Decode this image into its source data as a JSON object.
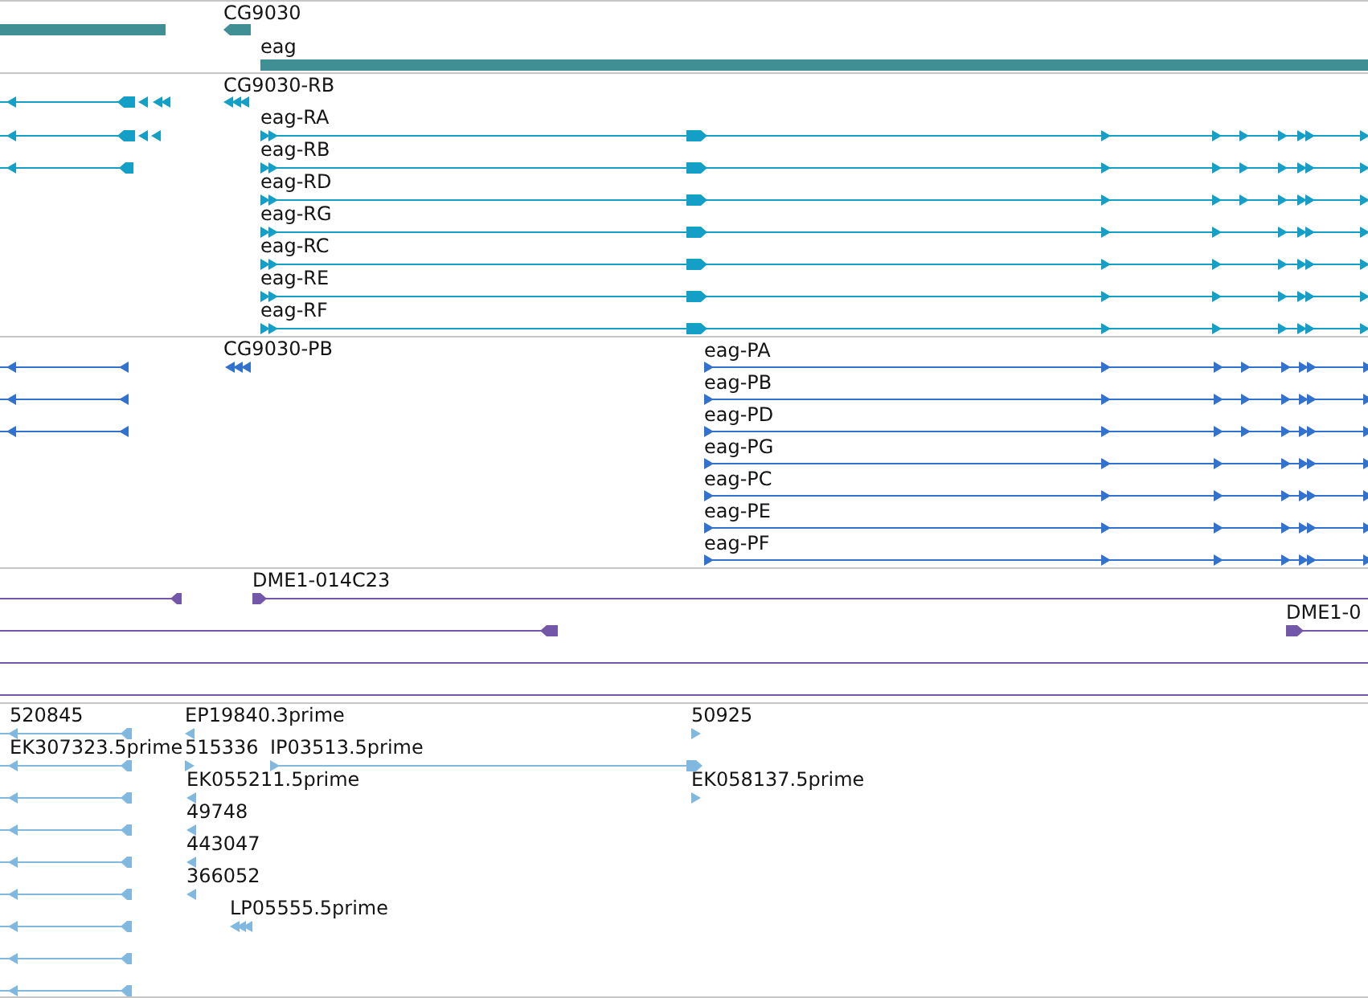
{
  "tracks": [
    {
      "kind": "gene",
      "features": [
        {
          "label": "CG9030"
        },
        {
          "label": "eag"
        }
      ]
    },
    {
      "kind": "transcript",
      "features": [
        {
          "label": "CG9030-RB"
        },
        {
          "label": "eag-RA"
        },
        {
          "label": "eag-RB"
        },
        {
          "label": "eag-RD"
        },
        {
          "label": "eag-RG"
        },
        {
          "label": "eag-RC"
        },
        {
          "label": "eag-RE"
        },
        {
          "label": "eag-RF"
        }
      ]
    },
    {
      "kind": "protein",
      "features": [
        {
          "label": "CG9030-PB"
        },
        {
          "label": "eag-PA"
        },
        {
          "label": "eag-PB"
        },
        {
          "label": "eag-PD"
        },
        {
          "label": "eag-PG"
        },
        {
          "label": "eag-PC"
        },
        {
          "label": "eag-PE"
        },
        {
          "label": "eag-PF"
        }
      ]
    },
    {
      "kind": "clone",
      "features": [
        {
          "label": "DME1-014C23"
        },
        {
          "label": "DME1-0"
        }
      ]
    },
    {
      "kind": "est",
      "features": [
        {
          "label": "520845"
        },
        {
          "label": "EP19840.3prime"
        },
        {
          "label": "50925"
        },
        {
          "label": "EK307323.5prime"
        },
        {
          "label": "515336"
        },
        {
          "label": "IP03513.5prime"
        },
        {
          "label": "EK055211.5prime"
        },
        {
          "label": "EK058137.5prime"
        },
        {
          "label": "49748"
        },
        {
          "label": "443047"
        },
        {
          "label": "366052"
        },
        {
          "label": "LP05555.5prime"
        }
      ]
    }
  ]
}
